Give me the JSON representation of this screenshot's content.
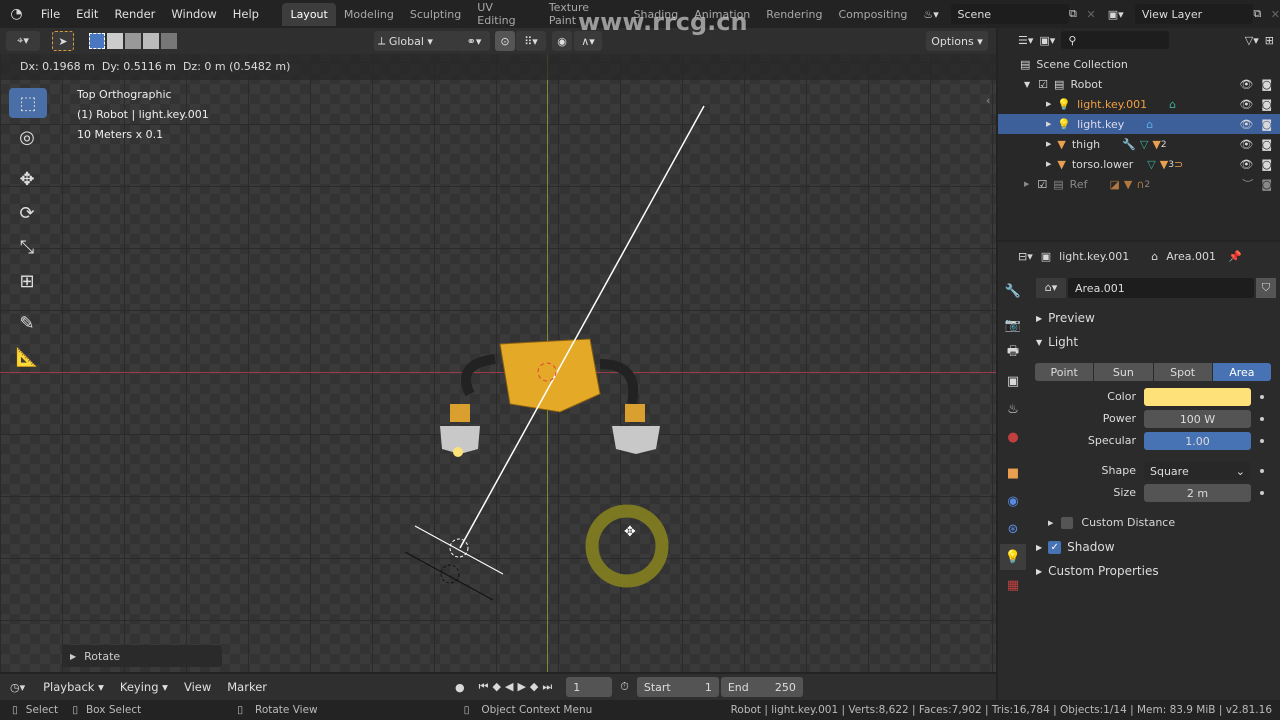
{
  "menu": [
    "File",
    "Edit",
    "Render",
    "Window",
    "Help"
  ],
  "workspaces": [
    "Layout",
    "Modeling",
    "Sculpting",
    "UV Editing",
    "Texture Paint",
    "Shading",
    "Animation",
    "Rendering",
    "Compositing"
  ],
  "scene": "Scene",
  "view_layer": "View Layer",
  "viewport": {
    "orientation": "Global",
    "options": "Options",
    "transform_readout": "Dx: 0.1968 m  Dy: 0.5116 m  Dz: 0 m (0.5482 m)",
    "view_name": "Top Orthographic",
    "object_info": "(1) Robot | light.key.001",
    "scale_info": "10 Meters x 0.1",
    "last_op": "Rotate"
  },
  "watermark": "www.rrcg.cn",
  "outliner": {
    "root": "Scene Collection",
    "items": [
      {
        "name": "Robot",
        "type": "collection"
      },
      {
        "name": "light.key.001",
        "type": "light",
        "active": true
      },
      {
        "name": "light.key",
        "type": "light",
        "selected": true
      },
      {
        "name": "thigh",
        "type": "mesh",
        "badge": "2"
      },
      {
        "name": "torso.lower",
        "type": "mesh",
        "badge": "3"
      },
      {
        "name": "Ref",
        "type": "collection",
        "badge": "2"
      }
    ]
  },
  "properties": {
    "object": "light.key.001",
    "data": "Area.001",
    "datablock": "Area.001",
    "panels": {
      "preview": "Preview",
      "light": "Light",
      "custom_distance": "Custom Distance",
      "shadow": "Shadow",
      "custom_props": "Custom Properties"
    },
    "light_types": [
      "Point",
      "Sun",
      "Spot",
      "Area"
    ],
    "active_type": "Area",
    "color_label": "Color",
    "color": "#ffe17a",
    "power_label": "Power",
    "power": "100 W",
    "specular_label": "Specular",
    "specular": "1.00",
    "shape_label": "Shape",
    "shape": "Square",
    "size_label": "Size",
    "size": "2 m",
    "shadow_checked": true,
    "custom_distance_checked": false
  },
  "timeline": {
    "playback": "Playback",
    "keying": "Keying",
    "view": "View",
    "marker": "Marker",
    "frame": "1",
    "start_label": "Start",
    "start": "1",
    "end_label": "End",
    "end": "250"
  },
  "status": {
    "select": "Select",
    "box_select": "Box Select",
    "rotate_view": "Rotate View",
    "context_menu": "Object Context Menu",
    "stats": "Robot | light.key.001 | Verts:8,622 | Faces:7,902 | Tris:16,784 | Objects:1/14 | Mem: 83.9 MiB | v2.81.16"
  }
}
